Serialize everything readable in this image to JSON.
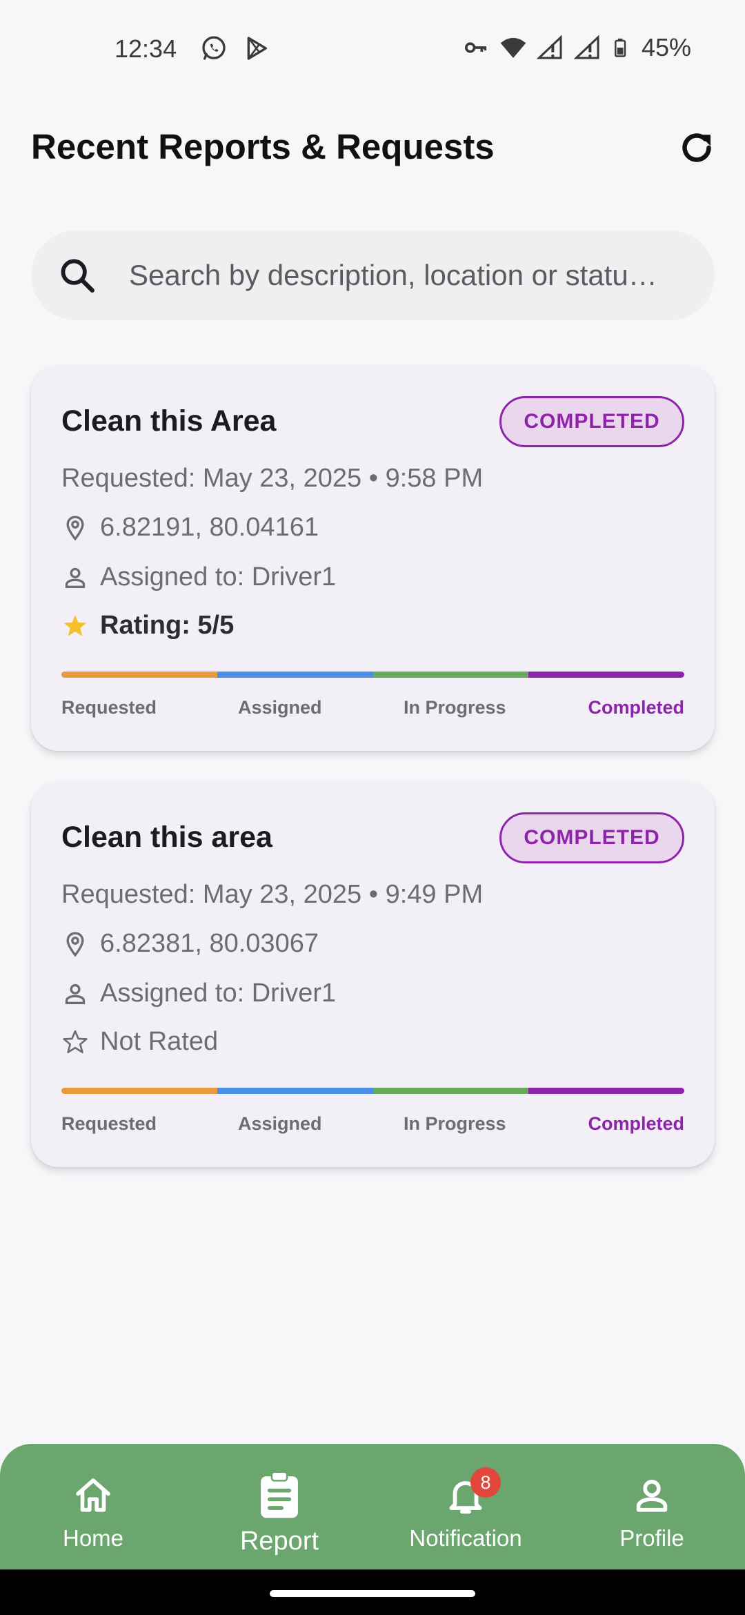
{
  "status_bar": {
    "time": "12:34",
    "battery": "45%"
  },
  "header": {
    "title": "Recent Reports & Requests"
  },
  "search": {
    "placeholder": "Search by description, location or statu…"
  },
  "reports": [
    {
      "title": "Clean this Area",
      "status": "COMPLETED",
      "requested": "Requested: May 23, 2025 • 9:58 PM",
      "location": "6.82191, 80.04161",
      "assigned": "Assigned to: Driver1",
      "rating": "Rating: 5/5",
      "rated": true
    },
    {
      "title": "Clean this area",
      "status": "COMPLETED",
      "requested": "Requested: May 23, 2025 • 9:49 PM",
      "location": "6.82381, 80.03067",
      "assigned": "Assigned to: Driver1",
      "rating": "Not Rated",
      "rated": false
    }
  ],
  "progress_steps": [
    "Requested",
    "Assigned",
    "In Progress",
    "Completed"
  ],
  "colors": {
    "accent_purple": "#8e24aa",
    "requested": "#e89a3c",
    "assigned": "#4a8fe7",
    "in_progress": "#67aa59",
    "completed": "#8e24aa",
    "nav_bg": "#6aa66d",
    "star": "#f5c02c"
  },
  "bottom_nav": {
    "items": [
      {
        "label": "Home",
        "icon": "home-icon"
      },
      {
        "label": "Report",
        "icon": "clipboard-icon"
      },
      {
        "label": "Notification",
        "icon": "bell-icon"
      },
      {
        "label": "Profile",
        "icon": "person-icon"
      }
    ],
    "notification_count": "8",
    "active": "Report"
  }
}
